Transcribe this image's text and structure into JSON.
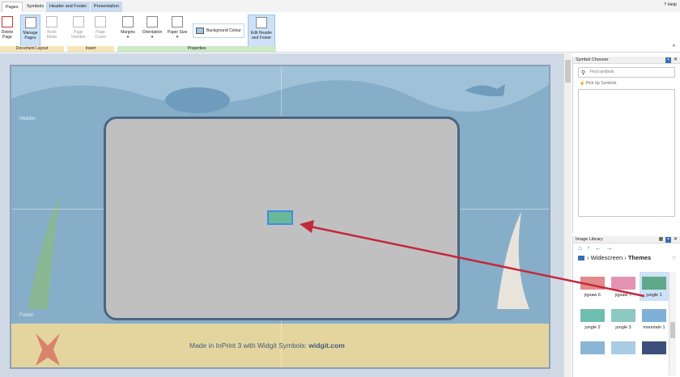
{
  "tabs": [
    {
      "label": "Pages"
    },
    {
      "label": "Symbols"
    },
    {
      "label": "Header and Footer"
    },
    {
      "label": "Presentation"
    }
  ],
  "help_label": "Help",
  "ribbon": {
    "delete_page": "Delete Page",
    "manage_pages": "Manage Pages",
    "book_mode": "Book Mode",
    "page_number": "Page Number",
    "page_count": "Page Count",
    "margins": "Margins",
    "orientation": "Orientation",
    "paper_size": "Paper Size",
    "background_colour": "Background Colour",
    "edit_header_footer": "Edit Header and Footer",
    "groups": {
      "document_layout": "Document Layout",
      "insert": "Insert",
      "properties": "Properties"
    }
  },
  "canvas": {
    "header_label": "Header",
    "footer_label": "Footer",
    "credit_prefix": "Made in InPrint 3 with Widgit Symbols: ",
    "credit_site": "widgit.com"
  },
  "symbol_chooser": {
    "title": "Symbol Chooser",
    "search_placeholder": "Find symbols",
    "pickup_label": "Pick Up Symbols"
  },
  "image_library": {
    "title": "Image Library",
    "breadcrumb_parent": "Widescreen",
    "breadcrumb_current": "Themes",
    "items": [
      {
        "label": "jigsaw 6",
        "color": "#e48a8a"
      },
      {
        "label": "jigsaw 7",
        "color": "#e493b3"
      },
      {
        "label": "jungle 1",
        "color": "#5fa88a"
      },
      {
        "label": "jungle 2",
        "color": "#6fbfb0"
      },
      {
        "label": "jungle 3",
        "color": "#8dc9c2"
      },
      {
        "label": "mountain 1",
        "color": "#7fb0d8"
      },
      {
        "label": "",
        "color": "#8ab6d6"
      },
      {
        "label": "",
        "color": "#a9cde4"
      },
      {
        "label": "",
        "color": "#3c4f7a"
      }
    ],
    "selected_item": "jungle 1"
  },
  "colors": {
    "accent": "#3b6fb6",
    "arrow": "#c4283b",
    "canvas_bg": "#86aec9",
    "frame": "#c0c0c0"
  }
}
